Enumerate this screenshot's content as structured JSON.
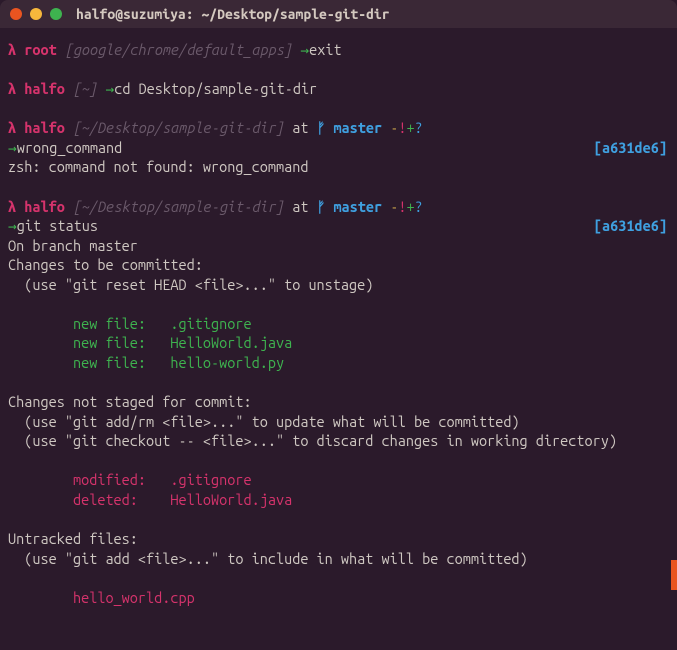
{
  "window": {
    "title": "halfo@suzumiya: ~/Desktop/sample-git-dir"
  },
  "blocks": [
    {
      "prompt": {
        "lambda": "λ",
        "user": "root",
        "path": "[google/chrome/default_apps]",
        "arrow": "→",
        "cmd": "exit"
      }
    },
    {
      "spacer": true
    },
    {
      "prompt": {
        "lambda": "λ",
        "user": "halfo",
        "path": "[~]",
        "arrow": "→",
        "cmd": "cd Desktop/sample-git-dir"
      }
    },
    {
      "spacer": true
    },
    {
      "prompt_git": {
        "lambda": "λ",
        "user": "halfo",
        "path": "[~/Desktop/sample-git-dir]",
        "at": "at",
        "branch_glyph": "ᚠ",
        "branch": "master",
        "flags": {
          "dash": "-",
          "excl": "!",
          "plus": "+",
          "qm": "?"
        }
      }
    },
    {
      "cmdline": {
        "arrow": "→",
        "cmd": "wrong_command",
        "hash_l": "[",
        "hash": "a631de6",
        "hash_r": "]"
      }
    },
    {
      "out_err": "zsh: command not found: wrong_command"
    },
    {
      "spacer": true
    },
    {
      "prompt_git": {
        "lambda": "λ",
        "user": "halfo",
        "path": "[~/Desktop/sample-git-dir]",
        "at": "at",
        "branch_glyph": "ᚠ",
        "branch": "master",
        "flags": {
          "dash": "-",
          "excl": "!",
          "plus": "+",
          "qm": "?"
        }
      }
    },
    {
      "cmdline": {
        "arrow": "→",
        "cmd": "git status",
        "hash_l": "[",
        "hash": "a631de6",
        "hash_r": "]"
      }
    },
    {
      "out": "On branch master"
    },
    {
      "out": "Changes to be committed:"
    },
    {
      "out": "  (use \"git reset HEAD <file>...\" to unstage)"
    },
    {
      "spacer": true
    },
    {
      "out_green": "        new file:   .gitignore"
    },
    {
      "out_green": "        new file:   HelloWorld.java"
    },
    {
      "out_green": "        new file:   hello-world.py"
    },
    {
      "spacer": true
    },
    {
      "out": "Changes not staged for commit:"
    },
    {
      "out": "  (use \"git add/rm <file>...\" to update what will be committed)"
    },
    {
      "out": "  (use \"git checkout -- <file>...\" to discard changes in working directory)"
    },
    {
      "spacer": true
    },
    {
      "out_red": "        modified:   .gitignore"
    },
    {
      "out_red": "        deleted:    HelloWorld.java"
    },
    {
      "spacer": true
    },
    {
      "out": "Untracked files:"
    },
    {
      "out": "  (use \"git add <file>...\" to include in what will be committed)"
    },
    {
      "spacer": true
    },
    {
      "out_red": "        hello_world.cpp"
    }
  ]
}
